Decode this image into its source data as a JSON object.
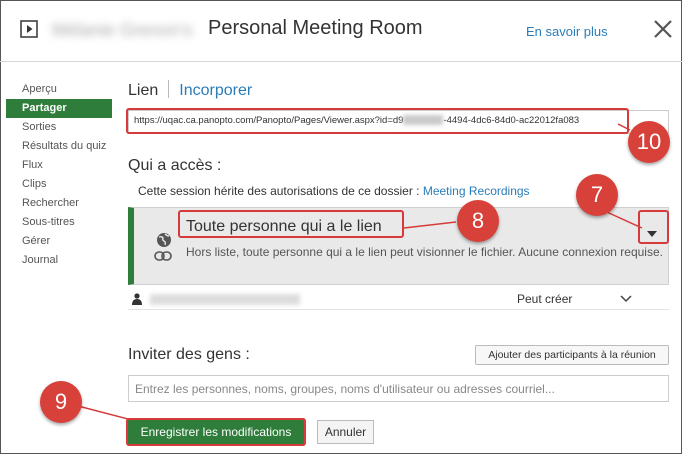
{
  "header": {
    "owner_name": "Mélanie Grenon's",
    "title": "Personal Meeting Room",
    "learn_more": "En savoir plus"
  },
  "sidebar": {
    "items": [
      {
        "label": "Aperçu",
        "active": false
      },
      {
        "label": "Partager",
        "active": true
      },
      {
        "label": "Sorties",
        "active": false
      },
      {
        "label": "Résultats du quiz",
        "active": false
      },
      {
        "label": "Flux",
        "active": false
      },
      {
        "label": "Clips",
        "active": false
      },
      {
        "label": "Rechercher",
        "active": false
      },
      {
        "label": "Sous-titres",
        "active": false
      },
      {
        "label": "Gérer",
        "active": false
      },
      {
        "label": "Journal",
        "active": false
      }
    ]
  },
  "tabs": {
    "link": "Lien",
    "embed": "Incorporer"
  },
  "share_url": {
    "prefix": "https://uqac.ca.panopto.com/Panopto/Pages/Viewer.aspx?id=d9",
    "suffix": "-4494-4dc6-84d0-ac22012fa083"
  },
  "access": {
    "title": "Qui a accès :",
    "inherit_text": "Cette session hérite des autorisations de ce dossier : ",
    "folder_link": "Meeting Recordings",
    "permission_title": "Toute personne qui a le lien",
    "permission_desc": "Hors liste, toute personne qui a le lien peut visionner le fichier. Aucune connexion requise.",
    "user_permission": "Peut créer"
  },
  "invite": {
    "title": "Inviter des gens :",
    "add_participants": "Ajouter des participants à la réunion",
    "placeholder": "Entrez les personnes, noms, groupes, noms d'utilisateur ou adresses courriel..."
  },
  "actions": {
    "save": "Enregistrer les modifications",
    "cancel": "Annuler"
  },
  "annotations": {
    "badge_7": "7",
    "badge_8": "8",
    "badge_9": "9",
    "badge_10": "10"
  },
  "colors": {
    "accent_green": "#2e7d3a",
    "link_blue": "#2a7db8",
    "annotation_red": "#d63a3a"
  },
  "icons": [
    "play-icon",
    "close-icon",
    "globe-icon",
    "link-icon",
    "caret-down-icon",
    "user-icon",
    "chevron-down-icon"
  ]
}
